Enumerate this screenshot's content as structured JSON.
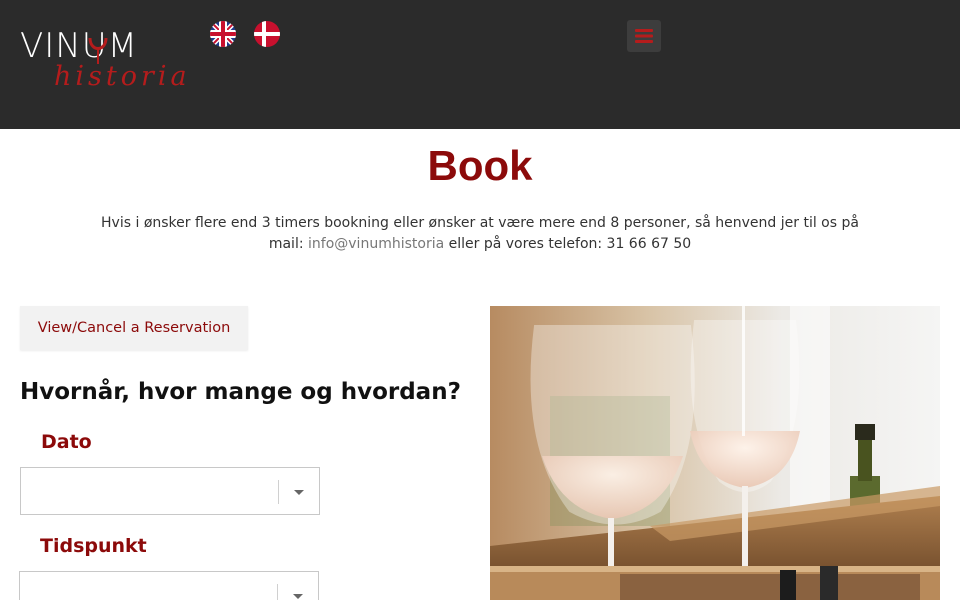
{
  "header": {
    "logo": {
      "line1": "VINUM",
      "line2": "historia"
    },
    "languages": [
      {
        "name": "English",
        "icon": "uk-flag-icon"
      },
      {
        "name": "Dansk",
        "icon": "danish-flag-icon"
      }
    ],
    "menu_icon": "hamburger-menu-icon",
    "colors": {
      "background": "#2b2b2b",
      "accent": "#b51c1c"
    }
  },
  "main": {
    "title": "Book",
    "intro_before": "Hvis i ønsker flere end 3 timers bookning eller ønsker at være mere end 8 personer, så henvend jer til os på mail: ",
    "intro_email": "info@vinumhistoria",
    "intro_after": " eller på vores telefon: 31 66 67 50",
    "view_cancel_label": "View/Cancel a Reservation",
    "section_heading": "Hvornår, hvor mange og hvordan?",
    "fields": {
      "date_label": "Dato",
      "date_value": "",
      "time_label": "Tidspunkt",
      "time_value": ""
    },
    "colors": {
      "title": "#8c0a0a",
      "label": "#8c0a0a"
    }
  }
}
